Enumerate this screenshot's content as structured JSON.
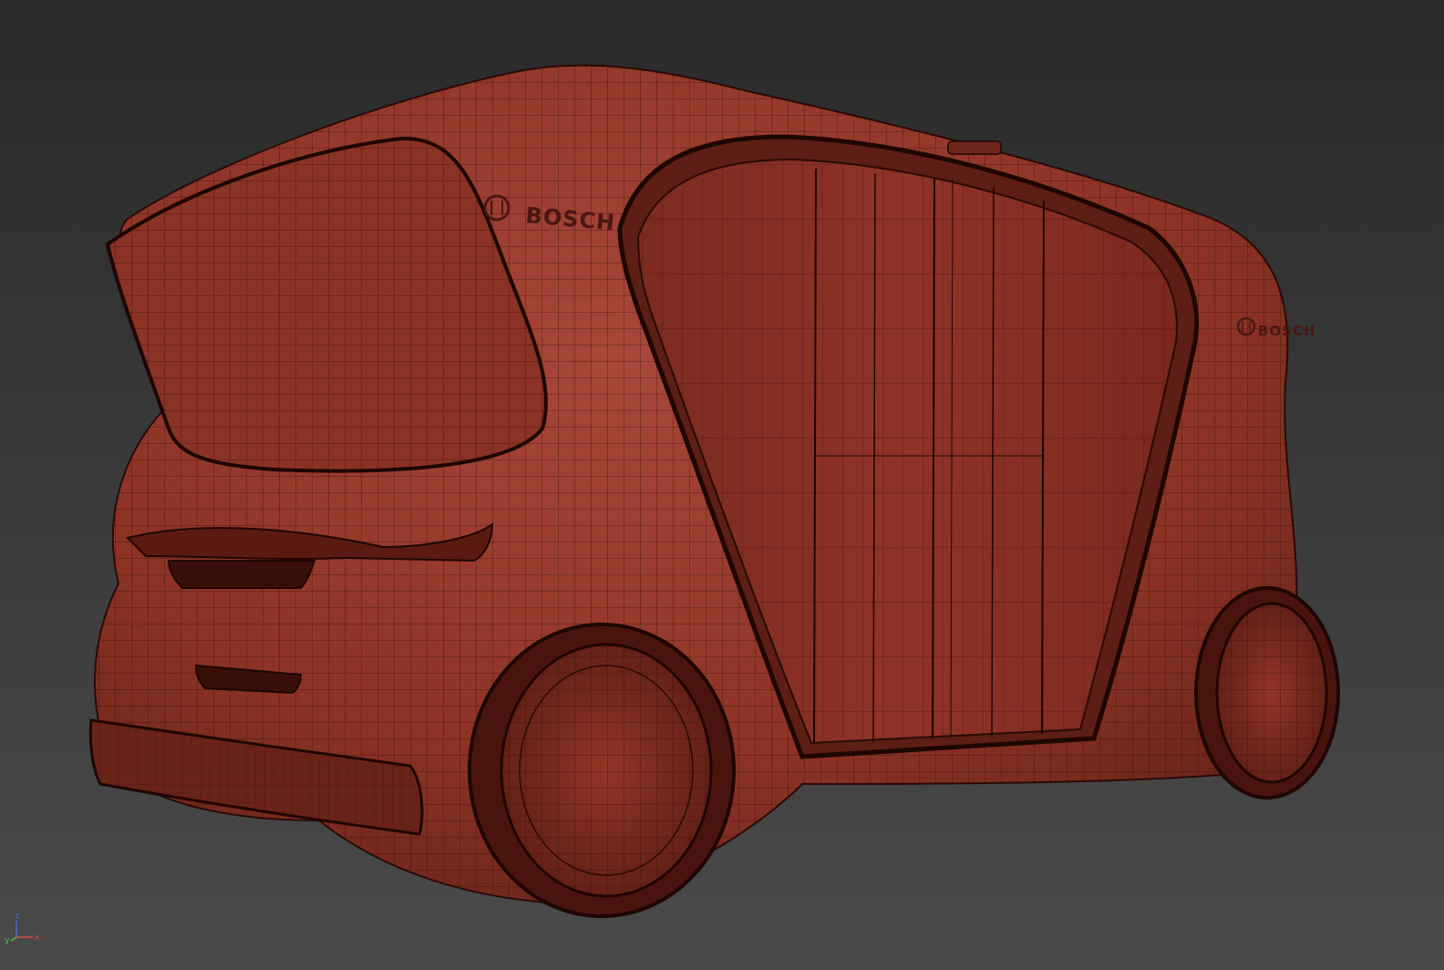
{
  "viewport": {
    "background_top": "#2a2a2a",
    "background_bottom": "#4a4a4a",
    "model_color": "#8c3325",
    "wire_color": "#2a0a06"
  },
  "model": {
    "brand_front": "BOSCH",
    "brand_side": "BOSCH"
  },
  "axis_gizmo": {
    "z_label": "z",
    "y_label": "y",
    "x_label": "x",
    "z_color": "#4a6ad8",
    "y_color": "#4cc04c",
    "x_color": "#d84a4a"
  }
}
